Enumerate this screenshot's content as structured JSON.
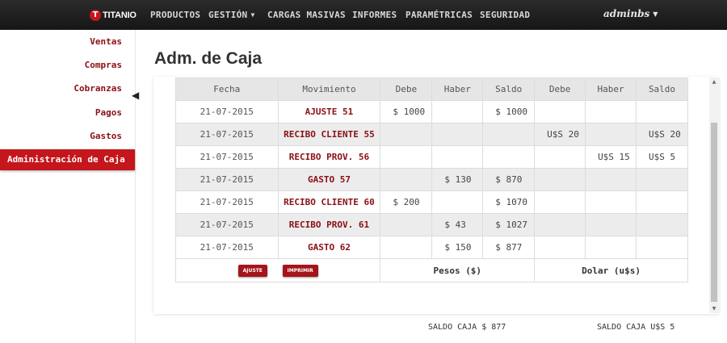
{
  "navbar": {
    "logo_letter": "T",
    "brand": "TITANIO",
    "items": [
      "PRODUCTOS",
      "GESTIÓN",
      "CARGAS MASIVAS",
      "INFORMES",
      "PARAMÉTRICAS",
      "SEGURIDAD"
    ],
    "user": "adminbs"
  },
  "sidebar": {
    "items": [
      "Ventas",
      "Compras",
      "Cobranzas",
      "Pagos",
      "Gastos",
      "Administración de Caja"
    ],
    "active_index": 5
  },
  "page": {
    "title": "Adm. de Caja"
  },
  "table": {
    "headers": [
      "Fecha",
      "Movimiento",
      "Debe",
      "Haber",
      "Saldo",
      "Debe",
      "Haber",
      "Saldo"
    ],
    "rows": [
      [
        "21-07-2015",
        "AJUSTE 51",
        "$ 1000",
        "",
        "$ 1000",
        "",
        "",
        ""
      ],
      [
        "21-07-2015",
        "RECIBO CLIENTE 55",
        "",
        "",
        "",
        "U$S 20",
        "",
        "U$S 20"
      ],
      [
        "21-07-2015",
        "RECIBO PROV. 56",
        "",
        "",
        "",
        "",
        "U$S 15",
        "U$S 5"
      ],
      [
        "21-07-2015",
        "GASTO 57",
        "",
        "$ 130",
        "$ 870",
        "",
        "",
        ""
      ],
      [
        "21-07-2015",
        "RECIBO CLIENTE 60",
        "$ 200",
        "",
        "$ 1070",
        "",
        "",
        ""
      ],
      [
        "21-07-2015",
        "RECIBO PROV. 61",
        "",
        "$ 43",
        "$ 1027",
        "",
        "",
        ""
      ],
      [
        "21-07-2015",
        "GASTO 62",
        "",
        "$ 150",
        "$ 877",
        "",
        "",
        ""
      ]
    ],
    "footer": {
      "ajuste_button": "AJUSTE",
      "imprimir_button": "IMPRIMIR",
      "pesos_label": "Pesos ($)",
      "dolar_label": "Dolar (u$s)"
    }
  },
  "summary": {
    "saldo_pesos": "SALDO CAJA $ 877",
    "saldo_dolar": "SALDO CAJA U$S 5"
  },
  "colors": {
    "accent": "#c4161c",
    "link": "#8b0f15",
    "navbar": "#1e1e1e"
  }
}
